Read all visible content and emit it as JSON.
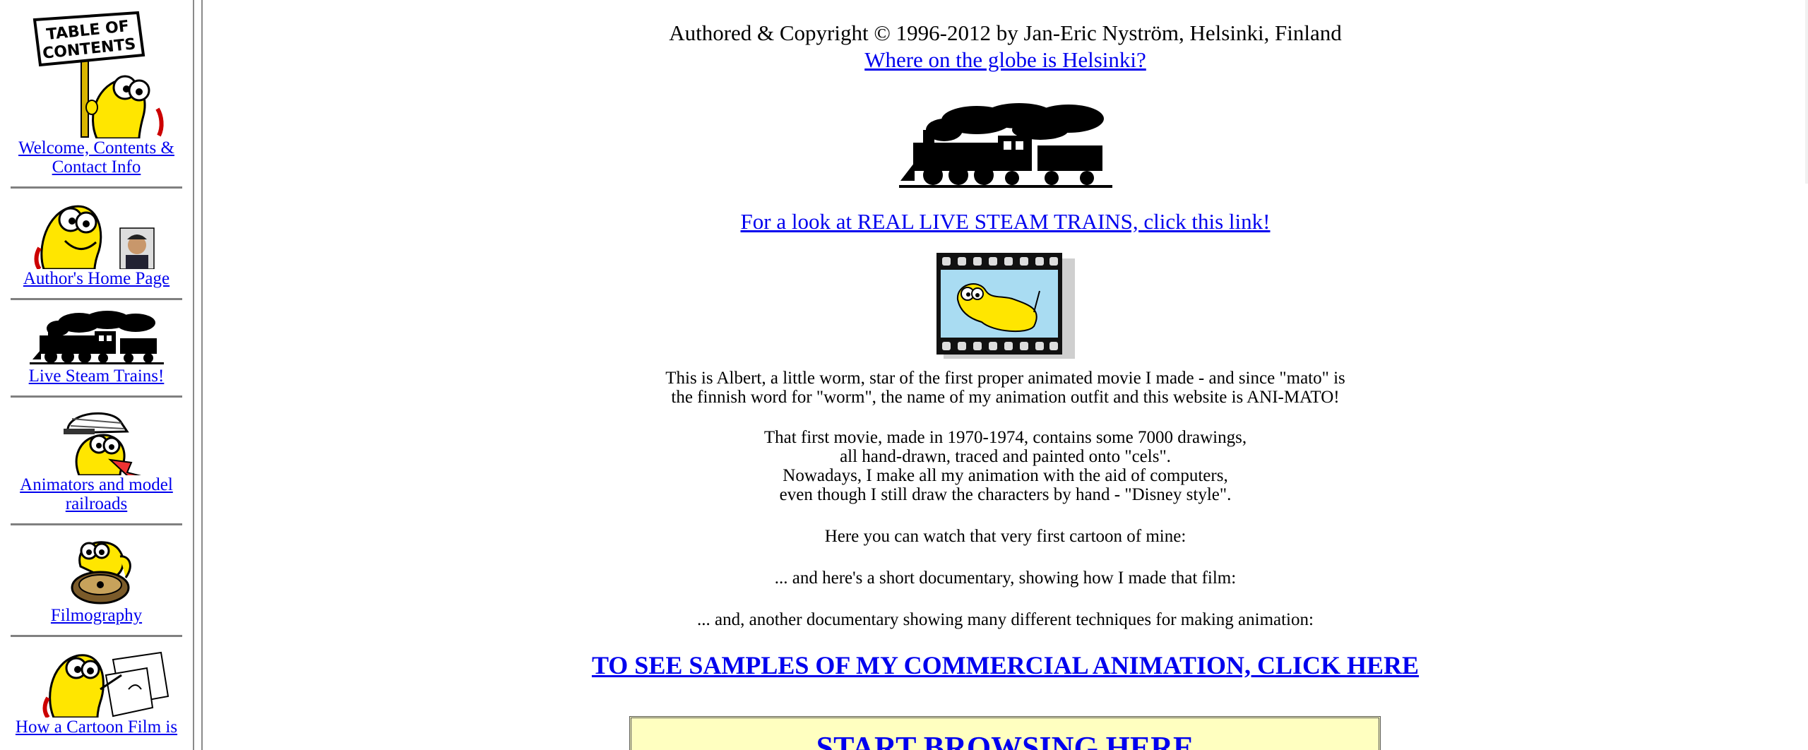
{
  "sidebar": {
    "items": [
      {
        "label": "Welcome, Contents & Contact Info",
        "icon": "table-of-contents-sign-icon"
      },
      {
        "label": "Author's Home Page",
        "icon": "worm-with-author-photo-icon"
      },
      {
        "label": "Live Steam Trains!",
        "icon": "steam-train-icon"
      },
      {
        "label": "Animators and model railroads",
        "icon": "worm-engineer-cap-icon"
      },
      {
        "label": "Filmography",
        "icon": "worm-film-reel-icon"
      },
      {
        "label": "How a Cartoon Film is",
        "icon": "worm-drawing-icon"
      }
    ],
    "sign_text": [
      "TABLE OF",
      "CONTENTS"
    ]
  },
  "main": {
    "copyright": "Authored & Copyright © 1996-2012 by Jan-Eric Nyström, Helsinki, Finland",
    "globe_link": "Where on the globe is Helsinki?",
    "steam_link": "For a look at REAL LIVE STEAM TRAINS, click this link!",
    "albert_lines": [
      "This is Albert, a little worm, star of the first proper animated movie I made - and since \"mato\" is",
      "the finnish word for \"worm\", the name of my animation outfit and this website is ANI-MATO!"
    ],
    "movie_lines": [
      "That first movie, made in 1970-1974, contains some 7000 drawings,",
      "all hand-drawn, traced and painted onto \"cels\".",
      "Nowadays, I make all my animation with the aid of computers,",
      "even though I still draw the characters by hand - \"Disney style\"."
    ],
    "watch_text": "Here you can watch that very first cartoon of mine:",
    "documentary_text": "... and here's a short documentary, showing how I made that film:",
    "techniques_text": "... and, another documentary showing many different techniques for making animation:",
    "commercial_link": "TO SEE SAMPLES OF MY COMMERCIAL ANIMATION, CLICK HERE",
    "start_browsing": "START BROWSING HERE"
  },
  "colors": {
    "link": "#0000ee",
    "worm_yellow": "#ffe600",
    "film_blue": "#a9dcf2",
    "start_box_bg": "#ffffc0",
    "divider": "#808080"
  }
}
